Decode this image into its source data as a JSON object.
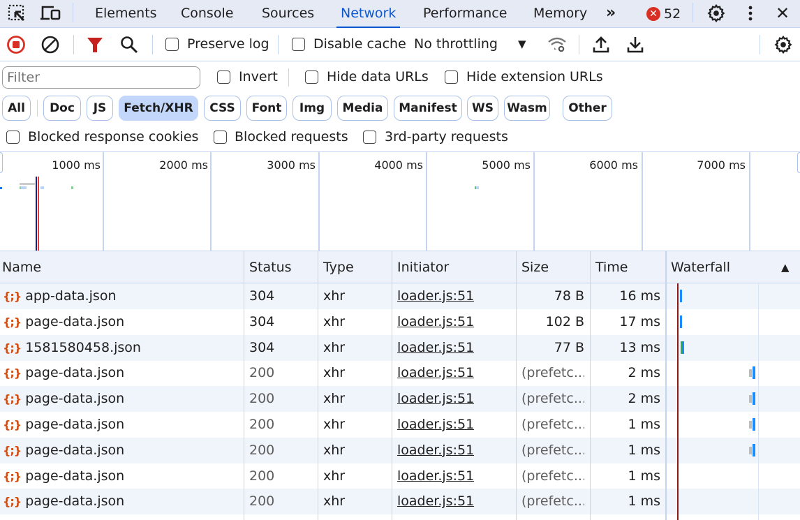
{
  "tabbar": {
    "icons": {
      "inspect": "inspect-element-icon",
      "device": "device-toolbar-icon"
    },
    "tabs": [
      "Elements",
      "Console",
      "Sources",
      "Network",
      "Performance",
      "Memory"
    ],
    "active_tab": "Network",
    "more_tabs": "»",
    "error_count": "52",
    "close": "✕"
  },
  "toolbar": {
    "preserve_log": "Preserve log",
    "disable_cache": "Disable cache",
    "throttling": "No throttling"
  },
  "filter": {
    "placeholder": "Filter",
    "invert": "Invert",
    "hide_data_urls": "Hide data URLs",
    "hide_extension_urls": "Hide extension URLs",
    "chips": [
      "All",
      "Doc",
      "JS",
      "Fetch/XHR",
      "CSS",
      "Font",
      "Img",
      "Media",
      "Manifest",
      "WS",
      "Wasm",
      "Other"
    ],
    "active_chip": "Fetch/XHR",
    "blocked_response_cookies": "Blocked response cookies",
    "blocked_requests": "Blocked requests",
    "third_party": "3rd-party requests"
  },
  "overview": {
    "ticks": [
      "1000 ms",
      "2000 ms",
      "3000 ms",
      "4000 ms",
      "5000 ms",
      "6000 ms",
      "7000 ms"
    ]
  },
  "table": {
    "columns": [
      "Name",
      "Status",
      "Type",
      "Initiator",
      "Size",
      "Time",
      "Waterfall"
    ],
    "sort_indicator": "▲",
    "rows": [
      {
        "name": "app-data.json",
        "status": "304",
        "type": "xhr",
        "initiator": "loader.js:51",
        "size": "78 B",
        "time": "16 ms"
      },
      {
        "name": "page-data.json",
        "status": "304",
        "type": "xhr",
        "initiator": "loader.js:51",
        "size": "102 B",
        "time": "17 ms"
      },
      {
        "name": "1581580458.json",
        "status": "304",
        "type": "xhr",
        "initiator": "loader.js:51",
        "size": "77 B",
        "time": "13 ms"
      },
      {
        "name": "page-data.json",
        "status": "200",
        "type": "xhr",
        "initiator": "loader.js:51",
        "size": "(prefetc...",
        "time": "2 ms"
      },
      {
        "name": "page-data.json",
        "status": "200",
        "type": "xhr",
        "initiator": "loader.js:51",
        "size": "(prefetc...",
        "time": "2 ms"
      },
      {
        "name": "page-data.json",
        "status": "200",
        "type": "xhr",
        "initiator": "loader.js:51",
        "size": "(prefetc...",
        "time": "1 ms"
      },
      {
        "name": "page-data.json",
        "status": "200",
        "type": "xhr",
        "initiator": "loader.js:51",
        "size": "(prefetc...",
        "time": "1 ms"
      },
      {
        "name": "page-data.json",
        "status": "200",
        "type": "xhr",
        "initiator": "loader.js:51",
        "size": "(prefetc...",
        "time": "1 ms"
      },
      {
        "name": "page-data.json",
        "status": "200",
        "type": "xhr",
        "initiator": "loader.js:51",
        "size": "(prefetc...",
        "time": "1 ms"
      }
    ]
  },
  "colors": {
    "accent": "#0b57d0",
    "record": "#d93025",
    "filter_active": "#c5221f",
    "json_icon": "#d14f14",
    "waterfall_bar": "#1a8cff",
    "waterfall_wait": "#34a853",
    "load_line": "#8b1a1a"
  }
}
